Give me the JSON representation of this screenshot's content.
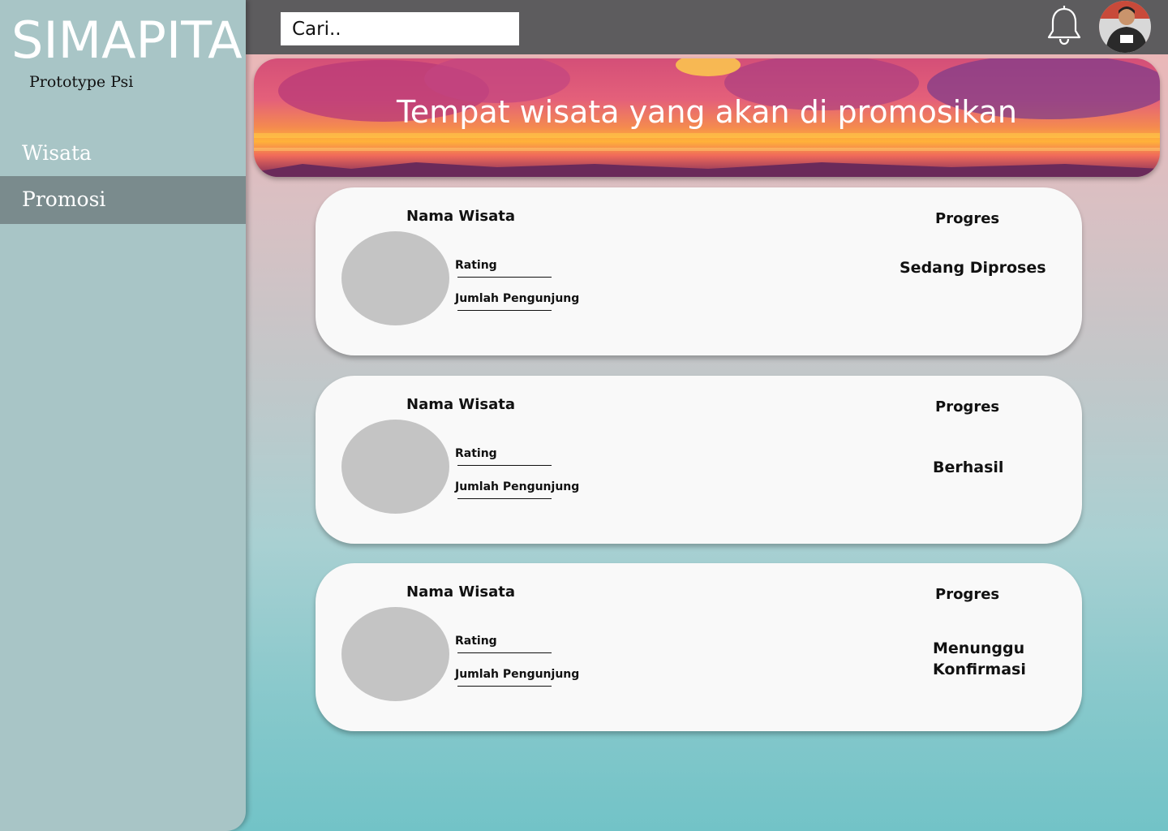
{
  "app": {
    "title": "SIMAPITA",
    "subtitle": "Prototype Psi"
  },
  "sidebar": {
    "items": [
      {
        "label": "Wisata",
        "active": false
      },
      {
        "label": "Promosi",
        "active": true
      }
    ]
  },
  "topbar": {
    "search_placeholder": "Cari..",
    "icons": [
      "bell-icon",
      "user-avatar"
    ]
  },
  "banner": {
    "title": "Tempat wisata yang akan di promosikan"
  },
  "cards": [
    {
      "name_label": "Nama Wisata",
      "rating_label": "Rating",
      "visitors_label": "Jumlah Pengunjung",
      "progress_label": "Progres",
      "status": "Sedang Diproses"
    },
    {
      "name_label": "Nama Wisata",
      "rating_label": "Rating",
      "visitors_label": "Jumlah Pengunjung",
      "progress_label": "Progres",
      "status": "Berhasil"
    },
    {
      "name_label": "Nama Wisata",
      "rating_label": "Rating",
      "visitors_label": "Jumlah Pengunjung",
      "progress_label": "Progres",
      "status": "Menunggu Konfirmasi"
    }
  ],
  "colors": {
    "sidebar": "#a8c5c6",
    "sidebar_active": "#7a8b8d",
    "topbar": "#5d5c5e",
    "card": "#f9f9f9",
    "thumbnail": "#c4c4c4"
  }
}
